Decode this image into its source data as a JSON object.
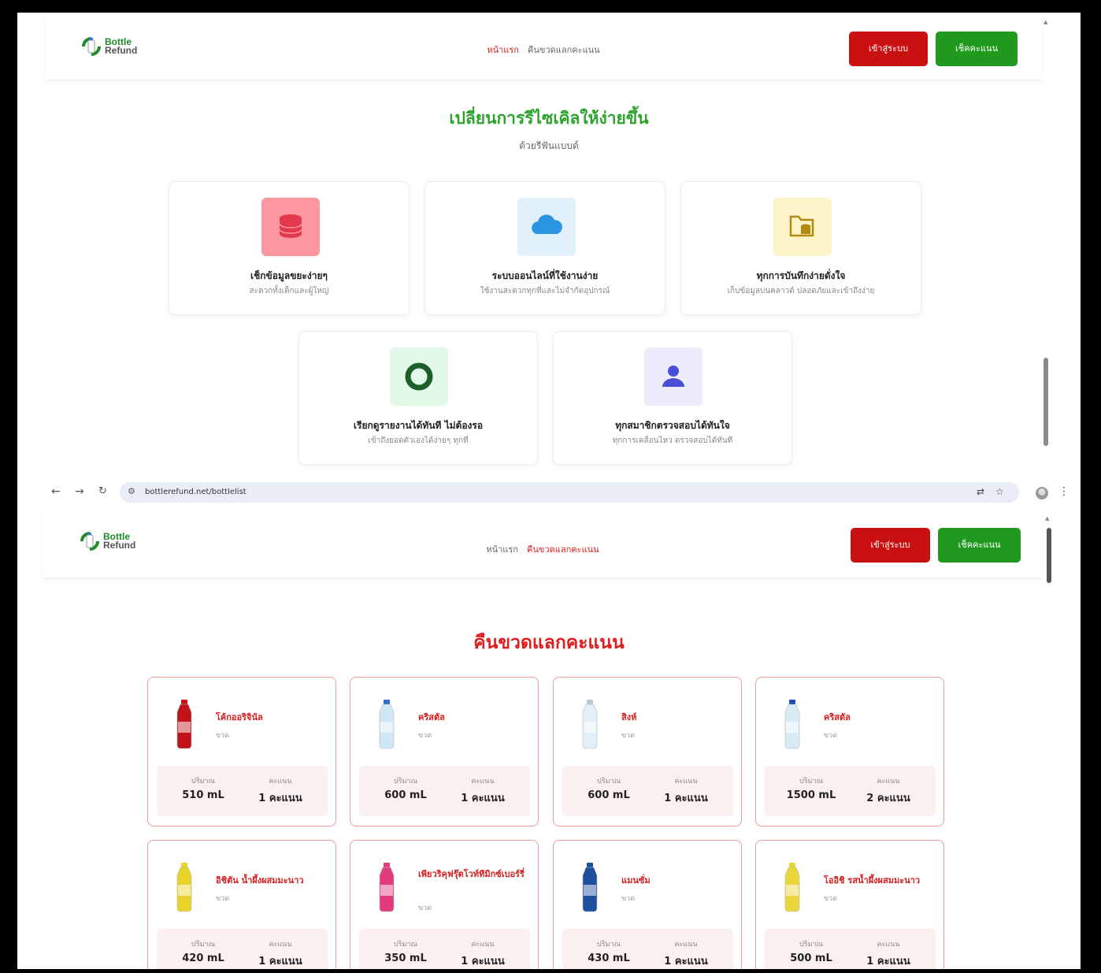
{
  "brand": {
    "line1": "Bottle",
    "line2": "Refund"
  },
  "nav": {
    "home": "หน้าแรก",
    "refund": "คืนขวดแลกคะแนน",
    "login": "เข้าสู่ระบบ",
    "check_points": "เช็คคะแนน"
  },
  "hero": {
    "title": "เปลี่ยนการรีไซเคิลให้ง่ายขึ้น",
    "subtitle": "ด้วยรีฟันแบบด์"
  },
  "features": [
    {
      "title": "เช็กข้อมูลขยะง่ายๆ",
      "desc": "สะดวกทั้งเด็กและผู้ใหญ่",
      "icon": "database-icon",
      "color": "#fc97a2"
    },
    {
      "title": "ระบบออนไลน์ที่ใช้งานง่าย",
      "desc": "ใช้งานสะดวกทุกที่และไม่จำกัดอุปกรณ์",
      "icon": "cloud-icon",
      "color": "#e1f1fc"
    },
    {
      "title": "ทุกการบันทึกง่ายดั่งใจ",
      "desc": "เก็บข้อมูลบนคลาวด์ ปลอดภัยและเข้าถึงง่าย",
      "icon": "folder-database-icon",
      "color": "#fdf5c9"
    },
    {
      "title": "เรียกดูรายงานได้ทันที ไม่ต้องรอ",
      "desc": "เข้าถึงยอดตัวเองได้ง่ายๆ ทุกที่",
      "icon": "ring-icon",
      "color": "#e2f8e8"
    },
    {
      "title": "ทุกสมาชิกตรวจสอบได้ทันใจ",
      "desc": "ทุกการเคลื่อนไหว ตรวจสอบได้ทันที",
      "icon": "user-icon",
      "color": "#ececfd"
    }
  ],
  "browser": {
    "url": "bottlerefund.net/bottlelist"
  },
  "refund_page": {
    "title": "คืนขวดแลกคะแนน",
    "volume_label": "ปริมาณ",
    "points_label": "คะแนน",
    "products": [
      {
        "name": "โค้กออริจินัล",
        "unit": "ขวด",
        "volume": "510 mL",
        "points": "1 คะแนน",
        "color": "#c0141a",
        "cap": "#c0141a"
      },
      {
        "name": "คริสตัล",
        "unit": "ขวด",
        "volume": "600 mL",
        "points": "1 คะแนน",
        "color": "#cfe6f4",
        "cap": "#2c6fc9"
      },
      {
        "name": "สิงห์",
        "unit": "ขวด",
        "volume": "600 mL",
        "points": "1 คะแนน",
        "color": "#e3eef6",
        "cap": "#b9c9d6"
      },
      {
        "name": "คริสตัล",
        "unit": "ขวด",
        "volume": "1500 mL",
        "points": "2 คะแนน",
        "color": "#d7eaf6",
        "cap": "#1d4fb8"
      },
      {
        "name": "อิชิตัน น้ำผึ้งผสมมะนาว",
        "unit": "ขวด",
        "volume": "420 mL",
        "points": "1 คะแนน",
        "color": "#e9d22a",
        "cap": "#e9d22a"
      },
      {
        "name": "เพียวริคุฟรุ๊ตโวท์ทีมิกซ์เบอร์รี่",
        "unit": "ขวด",
        "volume": "350 mL",
        "points": "1 คะแนน",
        "color": "#e23c7e",
        "cap": "#e23c7e"
      },
      {
        "name": "แมนซั่ม",
        "unit": "ขวด",
        "volume": "430 mL",
        "points": "1 คะแนน",
        "color": "#1e4f9c",
        "cap": "#1e4f9c"
      },
      {
        "name": "โออิชิ รสน้ำผึ้งผสมมะนาว",
        "unit": "ขวด",
        "volume": "500 mL",
        "points": "1 คะแนน",
        "color": "#ead63a",
        "cap": "#ead63a"
      }
    ]
  }
}
